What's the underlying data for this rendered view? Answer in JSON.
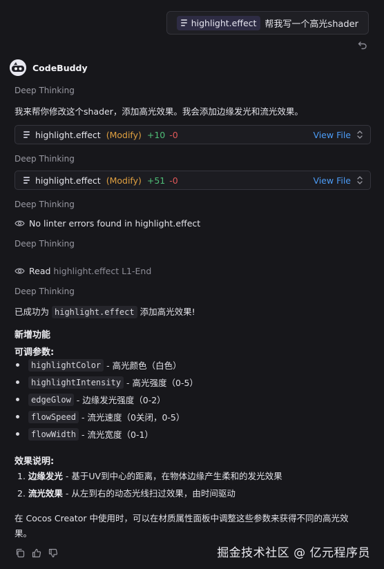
{
  "user_message": {
    "file_chip": "highlight.effect",
    "text": "帮我写一个高光shader"
  },
  "assistant": {
    "name": "CodeBuddy"
  },
  "messages": {
    "deep_thinking": "Deep Thinking",
    "intro": "我来帮你修改这个shader，添加高光效果。我会添加边缘发光和流光效果。",
    "edit1": {
      "file": "highlight.effect",
      "action": "(Modify)",
      "added": "+10",
      "removed": "-0",
      "view": "View File"
    },
    "edit2": {
      "file": "highlight.effect",
      "action": "(Modify)",
      "added": "+51",
      "removed": "-0",
      "view": "View File"
    },
    "linter": "No linter errors found in highlight.effect",
    "read_label": "Read",
    "read_target": "highlight.effect L1-End",
    "success_prefix": "已成功为",
    "success_code": "highlight.effect",
    "success_suffix": "添加高光效果!",
    "new_features": "新增功能",
    "params_title": "可调参数:",
    "params": [
      {
        "code": "highlightColor",
        "desc": "- 高光颜色（白色）"
      },
      {
        "code": "highlightIntensity",
        "desc": "- 高光强度（0-5）"
      },
      {
        "code": "edgeGlow",
        "desc": "- 边缘发光强度（0-2）"
      },
      {
        "code": "flowSpeed",
        "desc": "- 流光速度（0关闭，0-5）"
      },
      {
        "code": "flowWidth",
        "desc": "- 流光宽度（0-1）"
      }
    ],
    "effects_title": "效果说明:",
    "effects": [
      {
        "num": "1.",
        "bold": "边缘发光",
        "desc": "- 基于UV到中心的距离，在物体边缘产生柔和的发光效果"
      },
      {
        "num": "2.",
        "bold": "流光效果",
        "desc": "- 从左到右的动态光线扫过效果，由时间驱动"
      }
    ],
    "closing_line1": "在 Cocos Creator 中使用时，可以在材质属性面板中调整这些参数来获得不同的高光效",
    "closing_line2": "果。"
  },
  "watermark": "掘金技术社区 @ 亿元程序员",
  "colors": {
    "background": "#17171b",
    "link": "#4c9cf6",
    "modify": "#e0a040",
    "added": "#4fbf78",
    "removed": "#e05858"
  }
}
